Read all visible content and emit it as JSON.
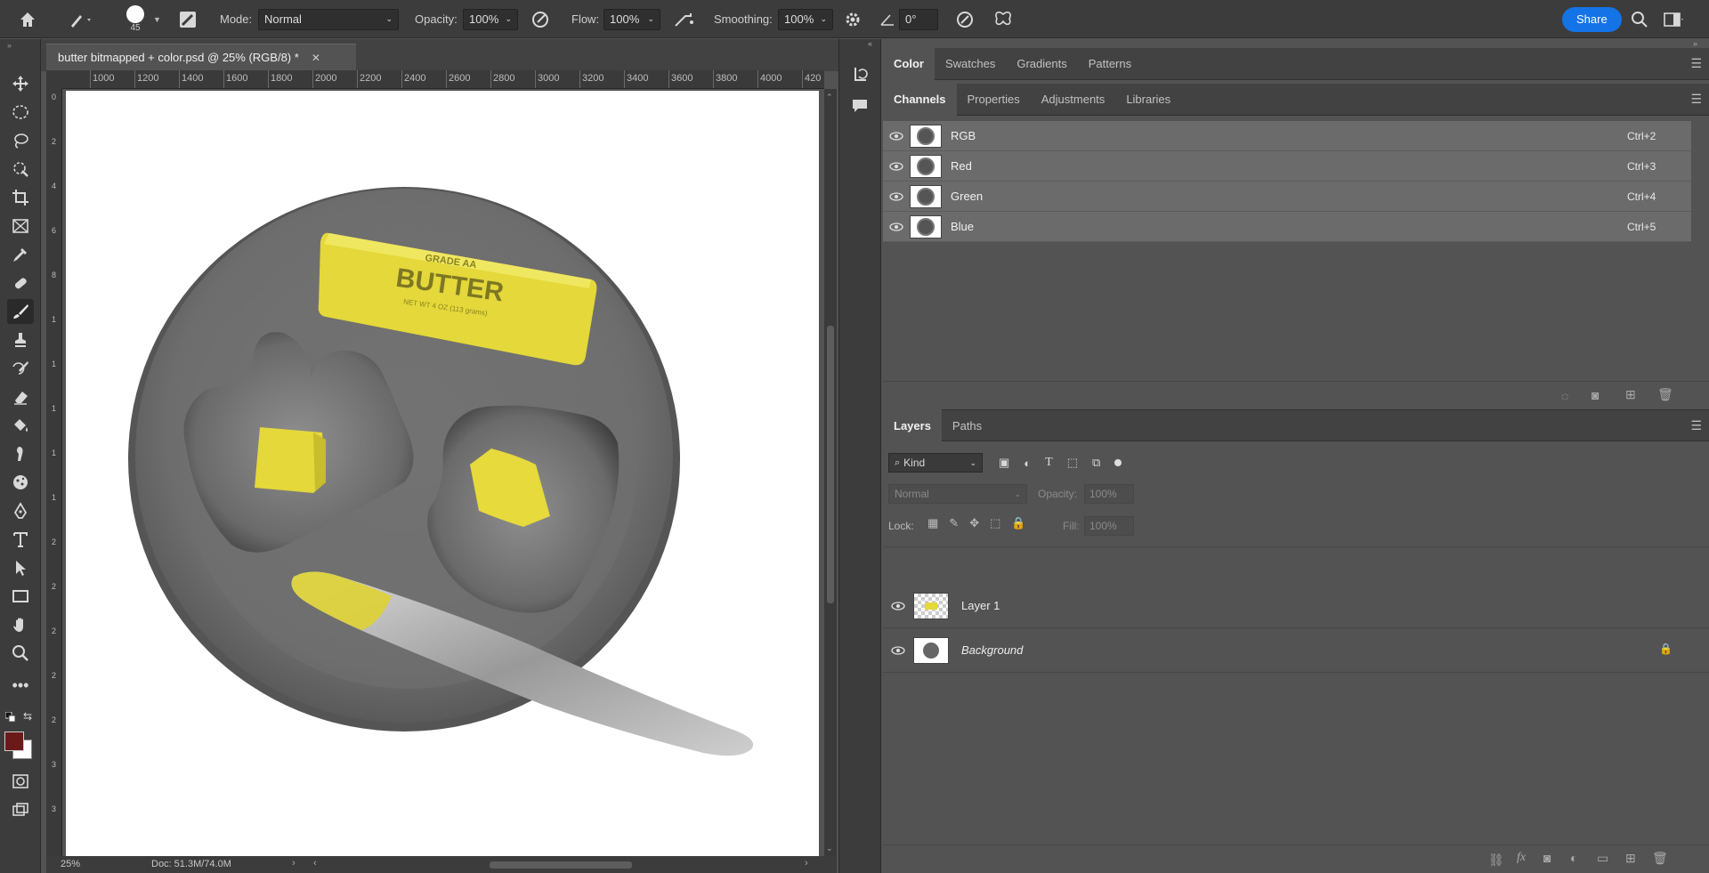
{
  "options_bar": {
    "brush_size": "45",
    "mode_label": "Mode:",
    "mode_value": "Normal",
    "opacity_label": "Opacity:",
    "opacity_value": "100%",
    "flow_label": "Flow:",
    "flow_value": "100%",
    "smoothing_label": "Smoothing:",
    "smoothing_value": "100%",
    "angle_value": "0°",
    "share_label": "Share"
  },
  "document": {
    "tab_title": "butter bitmapped + color.psd @ 25% (RGB/8) *",
    "ruler_ticks": [
      "1000",
      "1200",
      "1400",
      "1600",
      "1800",
      "2000",
      "2200",
      "2400",
      "2600",
      "2800",
      "3000",
      "3200",
      "3400",
      "3600",
      "3800",
      "4000",
      "420"
    ],
    "vruler_ticks": [
      "0",
      "2",
      "4",
      "6",
      "8",
      "1",
      "1",
      "1",
      "1",
      "1",
      "2",
      "2",
      "2",
      "2",
      "2",
      "3",
      "3"
    ],
    "zoom": "25%",
    "doc_info": "Doc: 51.3M/74.0M",
    "butter_text": "BUTTER",
    "butter_grade": "GRADE AA",
    "butter_net": "NET WT 4 OZ (113 grams)"
  },
  "color_panel": {
    "tabs": [
      "Color",
      "Swatches",
      "Gradients",
      "Patterns"
    ]
  },
  "channels_panel": {
    "tabs": [
      "Channels",
      "Properties",
      "Adjustments",
      "Libraries"
    ],
    "channels": [
      {
        "name": "RGB",
        "shortcut": "Ctrl+2"
      },
      {
        "name": "Red",
        "shortcut": "Ctrl+3"
      },
      {
        "name": "Green",
        "shortcut": "Ctrl+4"
      },
      {
        "name": "Blue",
        "shortcut": "Ctrl+5"
      }
    ]
  },
  "layers_panel": {
    "tabs": [
      "Layers",
      "Paths"
    ],
    "filter_kind": "Kind",
    "blend_mode": "Normal",
    "opacity_label": "Opacity:",
    "opacity_value": "100%",
    "lock_label": "Lock:",
    "fill_label": "Fill:",
    "fill_value": "100%",
    "layers": [
      {
        "name": "Layer 1"
      },
      {
        "name": "Background"
      }
    ]
  },
  "colors": {
    "foreground": "#6b1a1a",
    "background": "#ffffff",
    "accent": "#1473e6",
    "butter": "#e8dc3a"
  }
}
